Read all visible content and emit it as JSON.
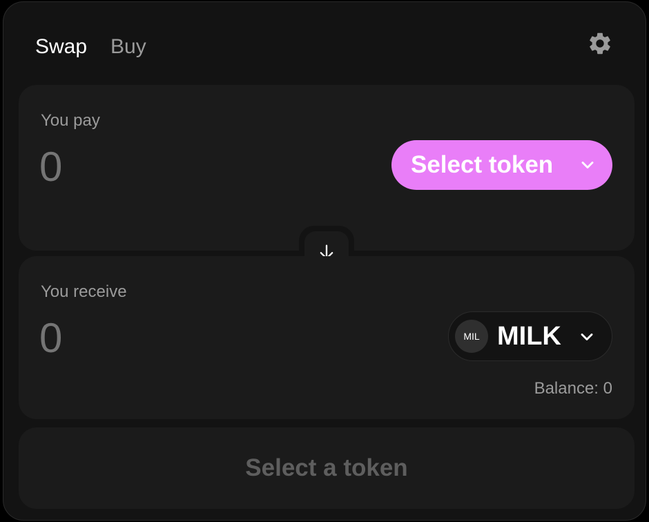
{
  "header": {
    "tabs": [
      {
        "label": "Swap",
        "active": true
      },
      {
        "label": "Buy",
        "active": false
      }
    ],
    "settings_icon": "gear-icon"
  },
  "pay": {
    "label": "You pay",
    "amount_placeholder": "0",
    "select_token_label": "Select token",
    "chevron_icon": "chevron-down-icon"
  },
  "switch": {
    "icon": "arrow-down-icon"
  },
  "receive": {
    "label": "You receive",
    "amount_placeholder": "0",
    "token": {
      "logo_text": "MIL",
      "symbol": "MILK"
    },
    "balance": "Balance: 0",
    "chevron_icon": "chevron-down-icon"
  },
  "action": {
    "label": "Select a token"
  },
  "colors": {
    "accent": "#e97ef8",
    "background": "#131313",
    "panel": "#1b1b1b",
    "muted_text": "#9b9b9b",
    "disabled_text": "#5e5e5e"
  }
}
